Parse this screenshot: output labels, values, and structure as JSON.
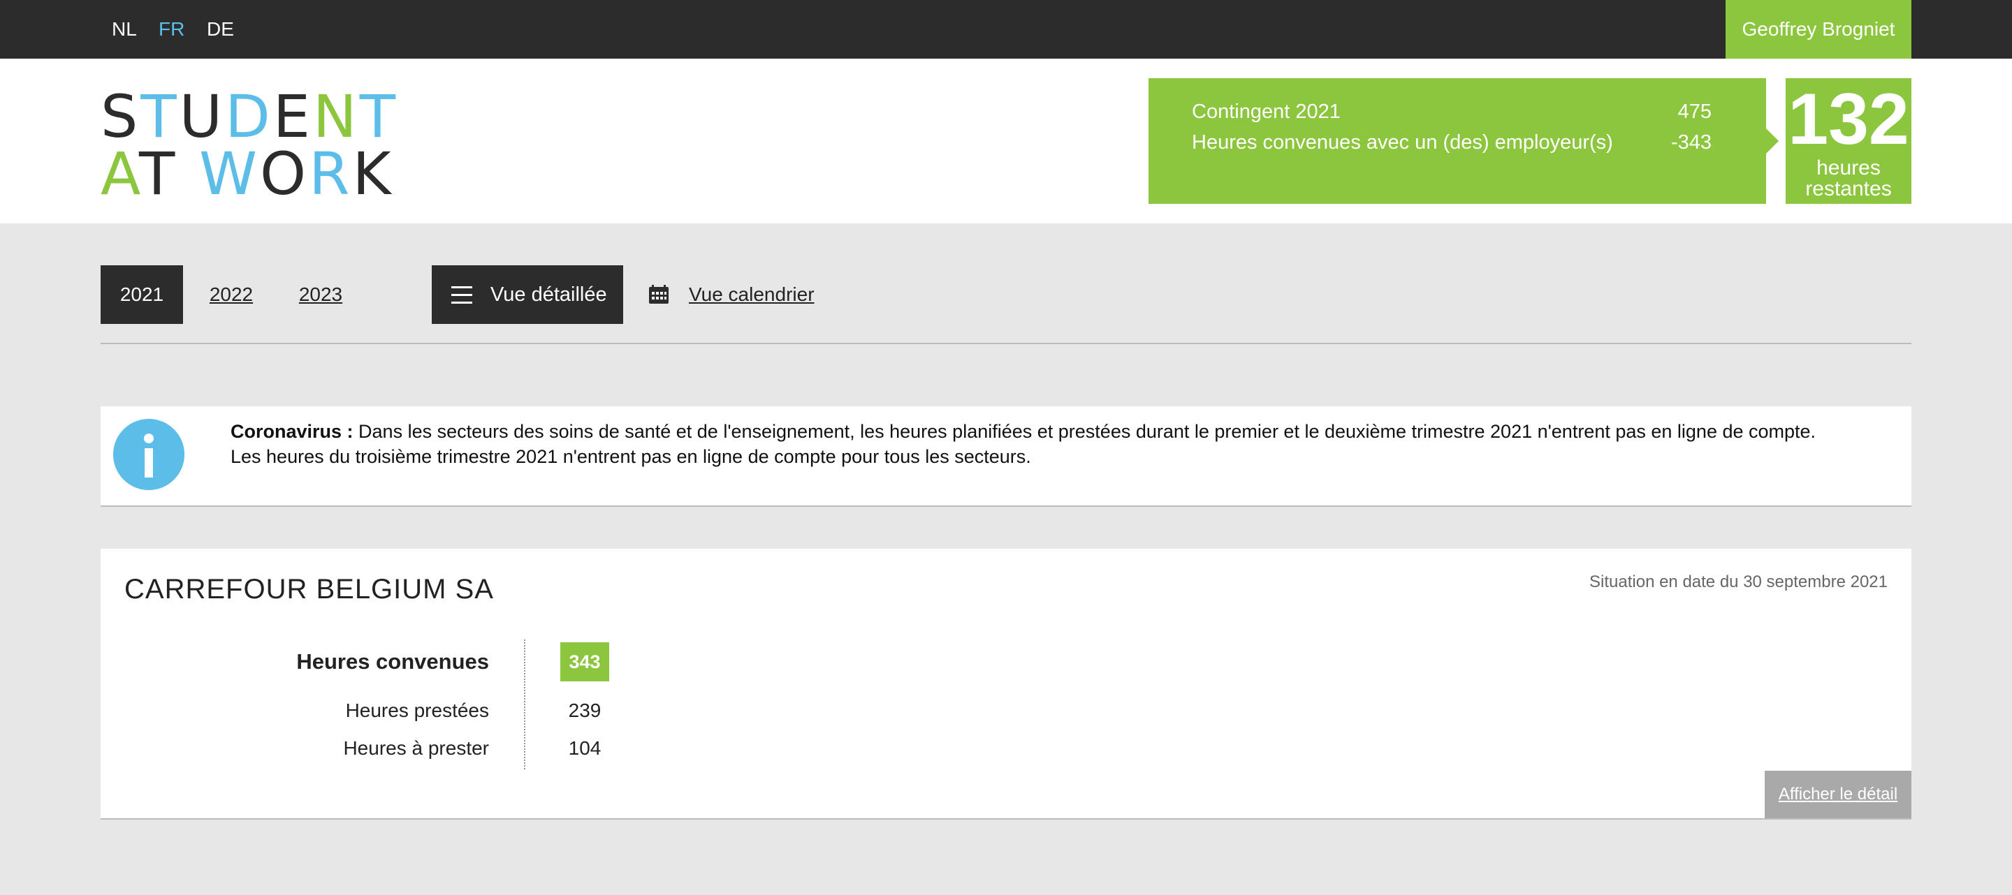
{
  "topbar": {
    "languages": [
      {
        "label": "NL",
        "active": false
      },
      {
        "label": "FR",
        "active": true
      },
      {
        "label": "DE",
        "active": false
      }
    ],
    "user_name": "Geoffrey Brogniet"
  },
  "logo": {
    "line1": "STUDENT",
    "line2": "AT WORK"
  },
  "contingent": {
    "label": "Contingent 2021",
    "value": "475",
    "agreed_label": "Heures convenues avec un (des) employeur(s)",
    "agreed_value": "-343",
    "remaining_value": "132",
    "remaining_label_1": "heures",
    "remaining_label_2": "restantes"
  },
  "toolbar": {
    "years": [
      "2021",
      "2022",
      "2023"
    ],
    "active_year": "2021",
    "detail_view_label": "Vue détaillée",
    "calendar_view_label": "Vue calendrier"
  },
  "info": {
    "bold_prefix": "Coronavirus :",
    "line1": " Dans les secteurs des soins de santé et de l'enseignement, les heures planifiées et prestées durant le premier et le deuxième trimestre 2021 n'entrent pas en ligne de compte.",
    "line2": "Les heures du troisième trimestre 2021 n'entrent pas en ligne de compte pour tous les secteurs."
  },
  "employer": {
    "name": "CARREFOUR BELGIUM SA",
    "situation": "Situation en date du 30 septembre 2021",
    "agreed_label": "Heures convenues",
    "agreed_value": "343",
    "performed_label": "Heures prestées",
    "performed_value": "239",
    "to_perform_label": "Heures à prester",
    "to_perform_value": "104",
    "detail_button": "Afficher le détail"
  },
  "colors": {
    "green": "#8cc63f",
    "blue": "#5bbde8",
    "dark": "#2c2c2c"
  }
}
